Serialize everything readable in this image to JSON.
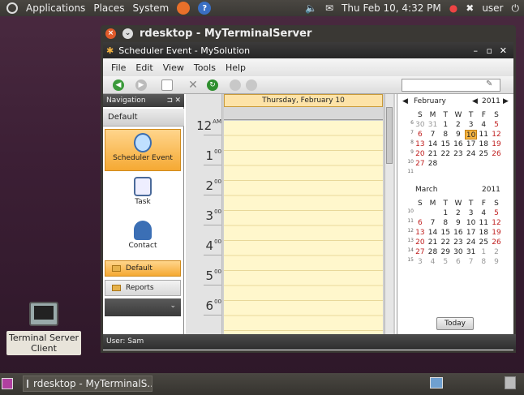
{
  "top_panel": {
    "menus": [
      "Applications",
      "Places",
      "System"
    ],
    "clock": "Thu Feb 10,  4:32 PM",
    "user": "user",
    "colors": {
      "panel": "#3d3b37",
      "firefox": "#e8702a",
      "help": "#3a6fc4"
    }
  },
  "desktop": {
    "icon_label": "Terminal Server Client"
  },
  "taskbar": {
    "window_button": "rdesktop - MyTerminalS..."
  },
  "rdesktop": {
    "title": "rdesktop - MyTerminalServer"
  },
  "app": {
    "title": "Scheduler Event - MySolution",
    "menu": [
      "File",
      "Edit",
      "View",
      "Tools",
      "Help"
    ]
  },
  "navigation": {
    "header": "Navigation",
    "group": "Default",
    "items": [
      {
        "label": "Scheduler Event",
        "icon": "alarm-clock-icon"
      },
      {
        "label": "Task",
        "icon": "clipboard-icon"
      },
      {
        "label": "Contact",
        "icon": "person-icon"
      }
    ],
    "bottom_items": [
      "Default",
      "Reports"
    ]
  },
  "dayview": {
    "date_header": "Thursday, February 10",
    "hours": [
      {
        "h": "12",
        "suffix": "AM"
      },
      {
        "h": "1",
        "suffix": "00"
      },
      {
        "h": "2",
        "suffix": "00"
      },
      {
        "h": "3",
        "suffix": "00"
      },
      {
        "h": "4",
        "suffix": "00"
      },
      {
        "h": "5",
        "suffix": "00"
      },
      {
        "h": "6",
        "suffix": "00"
      }
    ]
  },
  "calendar": {
    "year": "2011",
    "weekdays": [
      "S",
      "M",
      "T",
      "W",
      "T",
      "F",
      "S"
    ],
    "months": [
      {
        "name": "February",
        "weeks": [
          "6",
          "7",
          "8",
          "9",
          "10",
          "11"
        ],
        "days": [
          [
            "30",
            "31",
            "1",
            "2",
            "3",
            "4",
            "5"
          ],
          [
            "6",
            "7",
            "8",
            "9",
            "10",
            "11",
            "12"
          ],
          [
            "13",
            "14",
            "15",
            "16",
            "17",
            "18",
            "19"
          ],
          [
            "20",
            "21",
            "22",
            "23",
            "24",
            "25",
            "26"
          ],
          [
            "27",
            "28",
            "",
            "",
            "",
            "",
            ""
          ],
          [
            "",
            "",
            "",
            "",
            "",
            "",
            ""
          ]
        ]
      },
      {
        "name": "March",
        "weeks": [
          "10",
          "11",
          "12",
          "13",
          "14",
          "15"
        ],
        "days": [
          [
            "",
            "",
            "1",
            "2",
            "3",
            "4",
            "5"
          ],
          [
            "6",
            "7",
            "8",
            "9",
            "10",
            "11",
            "12"
          ],
          [
            "13",
            "14",
            "15",
            "16",
            "17",
            "18",
            "19"
          ],
          [
            "20",
            "21",
            "22",
            "23",
            "24",
            "25",
            "26"
          ],
          [
            "27",
            "28",
            "29",
            "30",
            "31",
            "1",
            "2"
          ],
          [
            "3",
            "4",
            "5",
            "6",
            "7",
            "8",
            "9"
          ]
        ]
      }
    ],
    "today_label": "Today"
  },
  "status": {
    "user": "User: Sam"
  }
}
